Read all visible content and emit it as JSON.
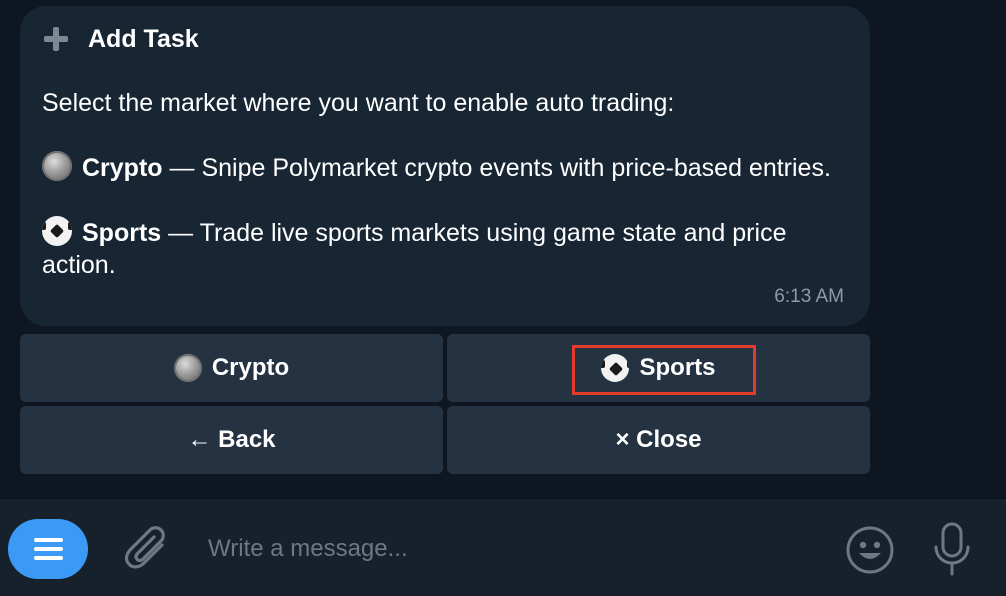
{
  "message": {
    "title": "Add Task",
    "intro": "Select the market where you want to enable auto trading:",
    "options": [
      {
        "icon": "coin-icon",
        "name": "Crypto",
        "description": " — Snipe Polymarket crypto events with price-based entries."
      },
      {
        "icon": "soccer-ball-icon",
        "name": "Sports",
        "description": " — Trade live sports markets using game state and price action."
      }
    ],
    "time": "6:13 AM"
  },
  "keyboard": {
    "crypto_label": "Crypto",
    "sports_label": "Sports",
    "back_label": "← Back",
    "close_label": "× Close"
  },
  "composer": {
    "placeholder": "Write a message..."
  },
  "colors": {
    "chat_bg": "#0e1621",
    "bubble_bg": "#182533",
    "button_bg": "#253242",
    "accent": "#3a9af5",
    "highlight": "#e23a2b"
  }
}
